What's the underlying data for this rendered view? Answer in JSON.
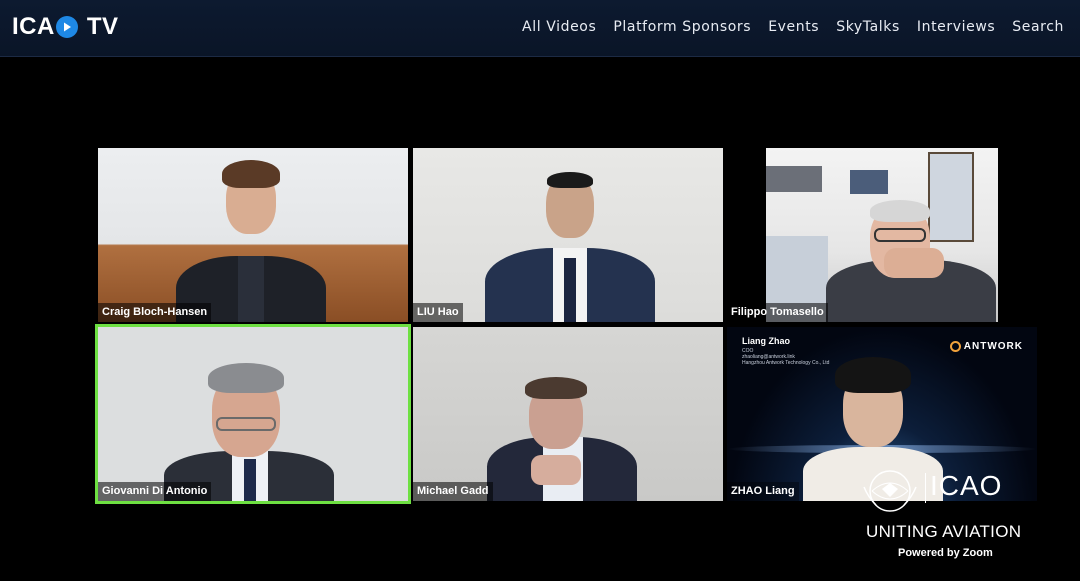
{
  "header": {
    "logo_left": "ICA",
    "logo_right": "TV",
    "nav": [
      "All Videos",
      "Platform Sponsors",
      "Events",
      "SkyTalks",
      "Interviews",
      "Search"
    ]
  },
  "participants": [
    {
      "name": "Craig Bloch-Hansen"
    },
    {
      "name": "LIU Hao"
    },
    {
      "name": "Filippo Tomasello"
    },
    {
      "name": "Giovanni Di Antonio",
      "active_speaker": true
    },
    {
      "name": "Michael Gadd"
    },
    {
      "name": "ZHAO Liang"
    }
  ],
  "slide": {
    "person": "Liang Zhao",
    "subtitle": "COO\nzhaoliang@antwork.link\nHangzhou Antwork Technology Co., Ltd",
    "company": "ANTWORK"
  },
  "branding": {
    "org": "ICAO",
    "tagline": "UNITING AVIATION",
    "powered": "Powered by Zoom"
  },
  "colors": {
    "header_bg": "#0d1a30",
    "accent_blue": "#1e88e5",
    "active_speaker_border": "#6ee042"
  }
}
